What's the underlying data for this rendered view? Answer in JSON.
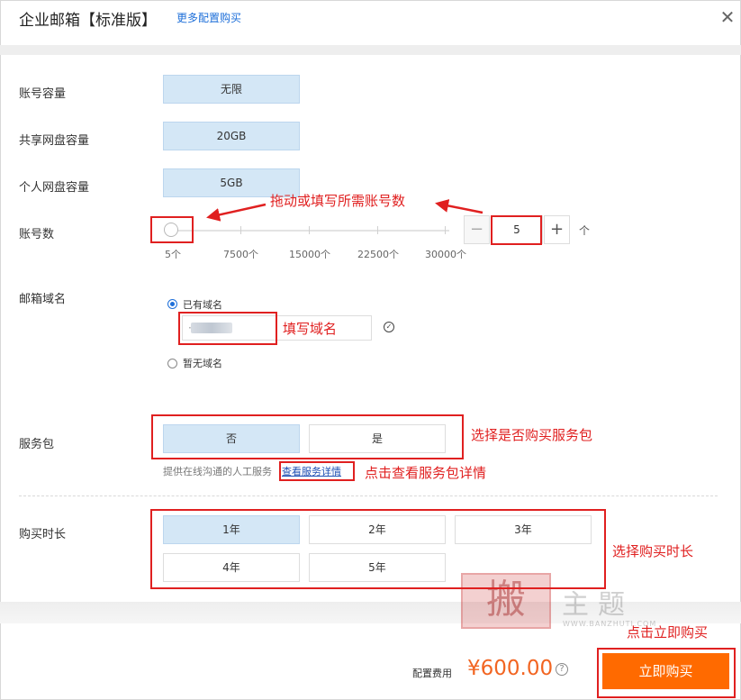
{
  "header": {
    "title": "企业邮箱【标准版】",
    "more_link": "更多配置购买",
    "close_symbol": "✕"
  },
  "rows": {
    "account_capacity": {
      "label": "账号容量",
      "value": "无限"
    },
    "shared_disk": {
      "label": "共享网盘容量",
      "value": "20GB"
    },
    "personal_disk": {
      "label": "个人网盘容量",
      "value": "5GB"
    },
    "account_count": {
      "label": "账号数",
      "ticks": [
        "5个",
        "7500个",
        "15000个",
        "22500个",
        "30000个"
      ],
      "slider_level": 0,
      "value": "5",
      "minus": "−",
      "plus": "+",
      "unit": "个"
    },
    "domain": {
      "label": "邮箱域名",
      "option_have": "已有域名",
      "option_none": "暂无域名",
      "selected": "已有域名",
      "input_prefix": "·",
      "verified_icon": "check-circle-icon"
    },
    "service_pack": {
      "label": "服务包",
      "options": [
        "否",
        "是"
      ],
      "selected": "否",
      "hint": "提供在线沟通的人工服务",
      "hint_link": "查看服务详情"
    },
    "duration": {
      "label": "购买时长",
      "options": [
        "1年",
        "2年",
        "3年",
        "4年",
        "5年"
      ],
      "selected": "1年"
    }
  },
  "footer": {
    "price_label": "配置费用",
    "price": "¥600.00",
    "help_symbol": "?",
    "buy_button": "立即购买"
  },
  "annotations": {
    "drag_or_fill": "拖动或填写所需账号数",
    "fill_domain": "填写域名",
    "choose_service": "选择是否购买服务包",
    "view_service": "点击查看服务包详情",
    "choose_duration": "选择购买时长",
    "click_buy": "点击立即购买"
  },
  "watermark": {
    "seal": "搬",
    "text": "主题",
    "sub": "WWW.BANZHUTI.COM"
  },
  "colors": {
    "accent": "#1e6fd9",
    "selected_bg": "#d4e7f6",
    "price": "#f26522",
    "buy_button": "#ff6a00",
    "annotation": "#e02020"
  }
}
